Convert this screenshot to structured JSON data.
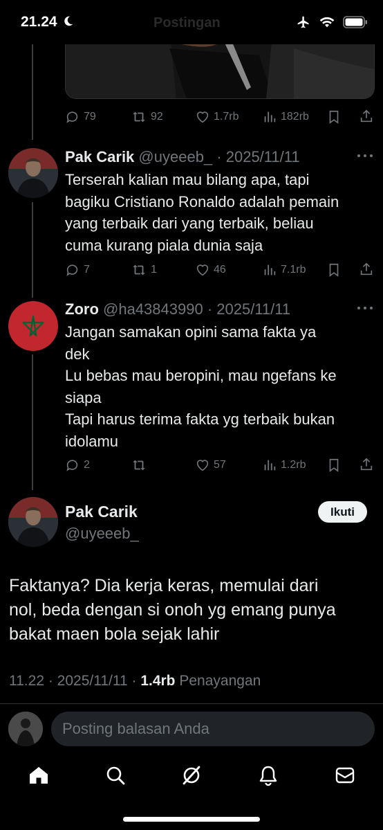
{
  "status_bar": {
    "time": "21.24",
    "title": "Postingan"
  },
  "tweets": [
    {
      "stats": {
        "replies": "79",
        "retweets": "92",
        "likes": "1.7rb",
        "views": "182rb"
      }
    },
    {
      "name": "Pak Carik",
      "handle": "@uyeeeb_",
      "date": "· 2025/11/11",
      "lines": [
        "Terserah kalian mau bilang apa, tapi",
        "bagiku Cristiano Ronaldo adalah pemain",
        "yang terbaik dari yang terbaik, beliau",
        "cuma kurang piala dunia saja"
      ],
      "stats": {
        "replies": "7",
        "retweets": "1",
        "likes": "46",
        "views": "7.1rb"
      }
    },
    {
      "name": "Zoro",
      "handle": "@ha43843990",
      "date": "· 2025/11/11",
      "lines": [
        "Jangan samakan opini sama fakta ya",
        "dek",
        "Lu bebas mau beropini, mau ngefans ke",
        "siapa",
        "Tapi harus terima fakta yg terbaik bukan",
        "idolamu"
      ],
      "stats": {
        "replies": "2",
        "retweets": "",
        "likes": "57",
        "views": "1.2rb"
      }
    }
  ],
  "main_post": {
    "name": "Pak Carik",
    "handle": "@uyeeeb_",
    "follow_label": "Ikuti",
    "lines": [
      "Faktanya? Dia kerja keras, memulai dari",
      "nol, beda dengan si onoh yg emang punya",
      "bakat maen bola sejak lahir"
    ],
    "time_date": "11.22 · 2025/11/11 ·",
    "views_count": "1.4rb",
    "views_label": "Penayangan"
  },
  "reply": {
    "placeholder": "Posting balasan Anda"
  },
  "tabbar": {
    "items": [
      "home-icon",
      "search-icon",
      "grok-icon",
      "notifications-icon",
      "messages-icon"
    ]
  },
  "colors": {
    "background": "#000000",
    "text": "#e7e9ea",
    "muted": "#71767b",
    "flag_red": "#c1272d",
    "flag_green": "#006233"
  }
}
